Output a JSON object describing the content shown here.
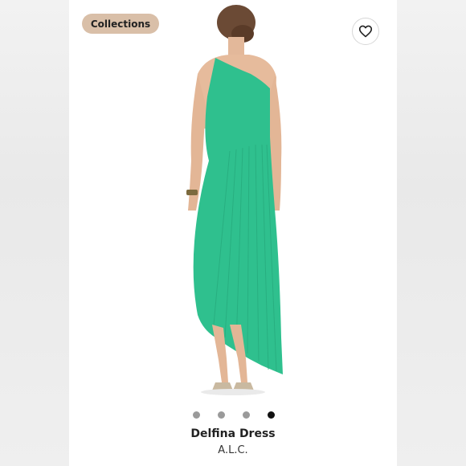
{
  "collections_button": {
    "label": "Collections"
  },
  "like_button": {
    "icon": "heart-outline-icon"
  },
  "product": {
    "title": "Delfina Dress",
    "brand": "A.L.C.",
    "dress_color": "#2fc08e"
  },
  "carousel": {
    "total": 4,
    "active_index": 4
  }
}
